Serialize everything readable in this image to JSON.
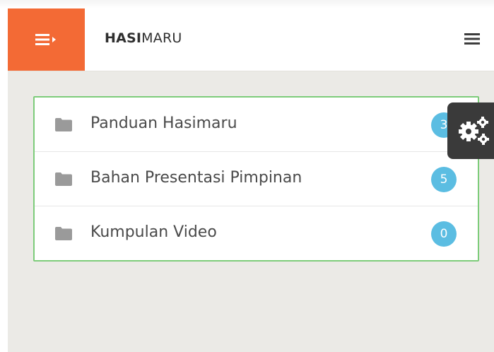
{
  "header": {
    "brand_bold": "HASI",
    "brand_light": "MARU",
    "toggle_icon": "menu-collapse-icon",
    "menu_icon": "hamburger-icon"
  },
  "folders": [
    {
      "label": "Panduan Hasimaru",
      "count": "3",
      "icon": "folder-icon"
    },
    {
      "label": "Bahan Presentasi Pimpinan",
      "count": "5",
      "icon": "folder-icon"
    },
    {
      "label": "Kumpulan Video",
      "count": "0",
      "icon": "folder-icon"
    }
  ],
  "settings": {
    "icon": "gears-icon"
  },
  "colors": {
    "accent": "#f36a35",
    "panel_border": "#7dcc7a",
    "badge": "#5bbde2",
    "background": "#ebeae6",
    "settings_bg": "#3a3a3a"
  }
}
